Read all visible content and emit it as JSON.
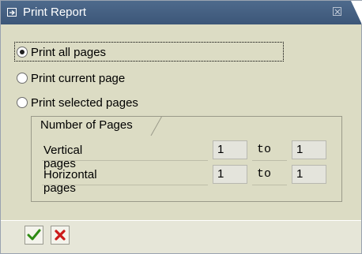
{
  "window": {
    "title": "Print Report"
  },
  "options": [
    {
      "label": "Print all pages",
      "checked": true
    },
    {
      "label": "Print current page",
      "checked": false
    },
    {
      "label": "Print selected pages",
      "checked": false
    }
  ],
  "group": {
    "title": "Number of Pages",
    "rows": [
      {
        "label": "Vertical pages",
        "from": "1",
        "to_label": "to",
        "to": "1"
      },
      {
        "label": "Horizontal pages",
        "from": "1",
        "to_label": "to",
        "to": "1"
      }
    ]
  },
  "buttons": [
    {
      "name": "confirm-button",
      "icon": "checkmark-icon",
      "color": "#2e8b12"
    },
    {
      "name": "cancel-button",
      "icon": "cross-icon",
      "color": "#cc1a1a"
    }
  ]
}
